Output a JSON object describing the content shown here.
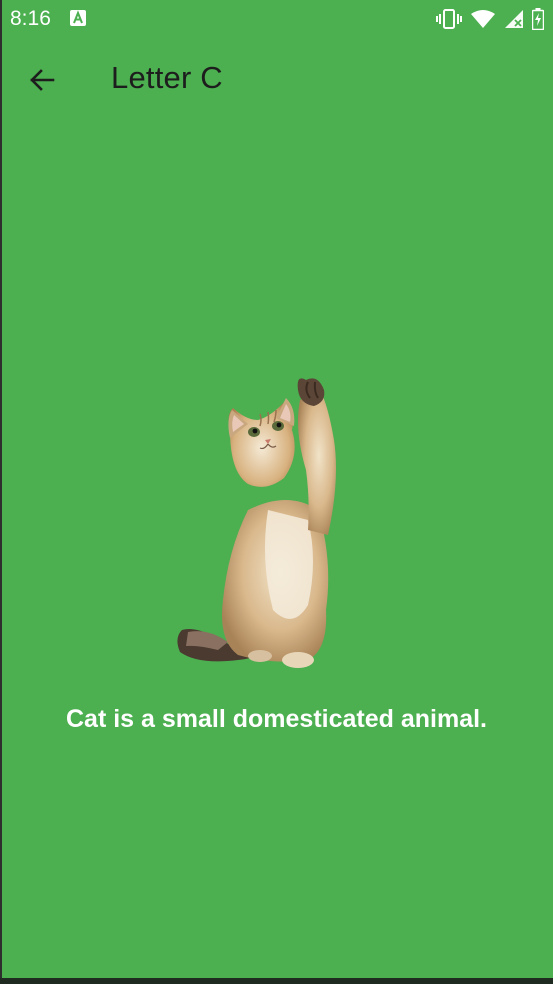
{
  "status_bar": {
    "time": "8:16",
    "icons": [
      "text-a-icon",
      "vibrate-icon",
      "wifi-icon",
      "signal-icon",
      "battery-charging-icon"
    ]
  },
  "app_bar": {
    "title": "Letter C",
    "back_icon": "arrow-back-icon"
  },
  "content": {
    "image": "cat-image",
    "description": "Cat is a small domesticated animal."
  },
  "colors": {
    "background": "#4caf50",
    "title_text": "#1d1d1d",
    "description_text": "#ffffff"
  }
}
